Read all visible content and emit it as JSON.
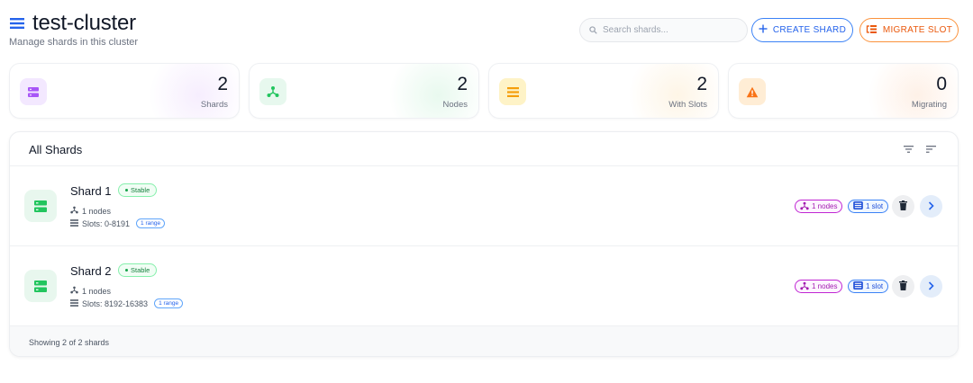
{
  "header": {
    "title": "test-cluster",
    "subtitle": "Manage shards in this cluster",
    "search_placeholder": "Search shards...",
    "create_label": "CREATE SHARD",
    "migrate_label": "MIGRATE SLOT"
  },
  "stats": [
    {
      "value": "2",
      "label": "Shards",
      "icon": "server-icon",
      "color": "#a855f7"
    },
    {
      "value": "2",
      "label": "Nodes",
      "icon": "hub-icon",
      "color": "#22c55e"
    },
    {
      "value": "2",
      "label": "With Slots",
      "icon": "list-icon",
      "color": "#f59e0b"
    },
    {
      "value": "0",
      "label": "Migrating",
      "icon": "warning-icon",
      "color": "#f97316"
    }
  ],
  "panel": {
    "title": "All Shards",
    "footer": "Showing 2 of 2 shards"
  },
  "shards": [
    {
      "name": "Shard 1",
      "status": "Stable",
      "nodes_text": "1 nodes",
      "slots_text": "Slots: 0-8191",
      "range_text": "1 range",
      "nodes_chip": "1 nodes",
      "slot_chip": "1 slot"
    },
    {
      "name": "Shard 2",
      "status": "Stable",
      "nodes_text": "1 nodes",
      "slots_text": "Slots: 8192-16383",
      "range_text": "1 range",
      "nodes_chip": "1 nodes",
      "slot_chip": "1 slot"
    }
  ],
  "colors": {
    "primary": "#2563eb",
    "warning": "#ea580c",
    "success": "#16a34a",
    "nodes_chip": "#a21caf"
  }
}
